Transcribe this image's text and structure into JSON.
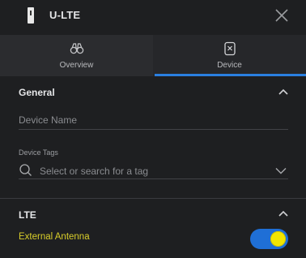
{
  "header": {
    "title": "U-LTE"
  },
  "tabs": [
    {
      "label": "Overview",
      "icon": "binoculars-icon",
      "active": false
    },
    {
      "label": "Device",
      "icon": "device-x-icon",
      "active": true
    }
  ],
  "general": {
    "title": "General",
    "device_name_placeholder": "Device Name",
    "device_tags_label": "Device Tags",
    "tag_search_placeholder": "Select or search for a tag"
  },
  "lte": {
    "title": "LTE",
    "external_antenna_label": "External Antenna",
    "external_antenna_enabled": true
  },
  "colors": {
    "accent": "#2a7fe0",
    "highlight_text": "#d9ce2a",
    "toggle_on": "#1f6fd6",
    "toggle_knob": "#f1e500"
  }
}
